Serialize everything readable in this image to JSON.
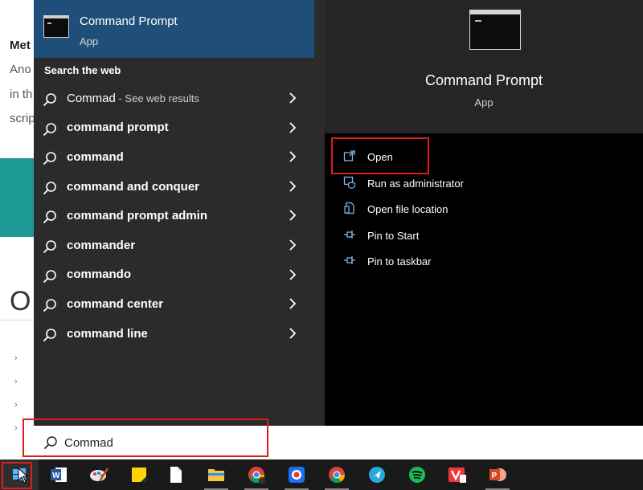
{
  "background_page": {
    "title_fragment": "Met",
    "lines": [
      "Ano",
      "in th",
      "scrip"
    ],
    "heading_fragment": "O",
    "bullets": [
      "›",
      "›",
      "›",
      "›"
    ]
  },
  "best_match": {
    "name": "Command Prompt",
    "type": "App"
  },
  "search_web": {
    "heading": "Search the web",
    "results": [
      {
        "label": "Commad",
        "suffix": " - See web results"
      },
      {
        "label": "command prompt",
        "suffix": ""
      },
      {
        "label": "command",
        "suffix": ""
      },
      {
        "label": "command and conquer",
        "suffix": ""
      },
      {
        "label": "command prompt admin",
        "suffix": ""
      },
      {
        "label": "commander",
        "suffix": ""
      },
      {
        "label": "commando",
        "suffix": ""
      },
      {
        "label": "command center",
        "suffix": ""
      },
      {
        "label": "command line",
        "suffix": ""
      }
    ]
  },
  "preview": {
    "name": "Command Prompt",
    "type": "App",
    "actions": [
      {
        "label": "Open",
        "icon": "open-icon"
      },
      {
        "label": "Run as administrator",
        "icon": "shield-icon"
      },
      {
        "label": "Open file location",
        "icon": "file-location-icon"
      },
      {
        "label": "Pin to Start",
        "icon": "pin-icon"
      },
      {
        "label": "Pin to taskbar",
        "icon": "pin-icon"
      }
    ]
  },
  "search_bar": {
    "value": "Commad"
  },
  "taskbar": {
    "apps": [
      "windows-start-icon",
      "word-icon",
      "paint-icon",
      "sticky-notes-icon",
      "file-icon",
      "file-explorer-icon",
      "chrome-icon",
      "camera-icon",
      "chrome-icon",
      "app-icon",
      "spotify-icon",
      "vivaldi-icon",
      "powerpoint-icon"
    ]
  },
  "colors": {
    "accent": "#1f4f78",
    "highlight": "#e01b1b",
    "action_icon": "#7eb6e8"
  }
}
